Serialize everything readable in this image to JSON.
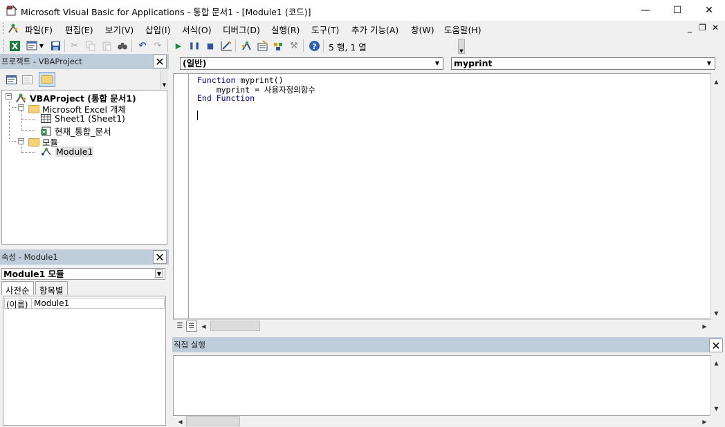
{
  "window": {
    "title": "Microsoft Visual Basic for Applications - 통합 문서1 - [Module1 (코드)]",
    "minimize": "—",
    "maximize": "☐",
    "close": "✕"
  },
  "menu": {
    "items": [
      "파일(F)",
      "편집(E)",
      "보기(V)",
      "삽입(I)",
      "서식(O)",
      "디버그(D)",
      "실행(R)",
      "도구(T)",
      "추가 기능(A)",
      "창(W)",
      "도움말(H)"
    ],
    "mdi_min": "_",
    "mdi_restore": "❐",
    "mdi_close": "✕"
  },
  "toolbar": {
    "status": "5 행, 1 열",
    "icons": [
      "excel-icon",
      "insert-module-icon",
      "save-icon",
      "cut-icon",
      "copy-icon",
      "paste-icon",
      "find-icon",
      "undo-icon",
      "redo-icon",
      "run-icon",
      "break-icon",
      "reset-icon",
      "design-mode-icon",
      "project-explorer-icon",
      "properties-icon",
      "object-browser-icon",
      "toolbox-icon",
      "help-icon"
    ]
  },
  "project_explorer": {
    "title": "프로젝트 - VBAProject",
    "tree": {
      "root": "VBAProject (통합 문서1)",
      "folder_objects": "Microsoft Excel 개체",
      "sheet1": "Sheet1 (Sheet1)",
      "workbook": "현재_통합_문서",
      "folder_modules": "모듈",
      "module1": "Module1"
    }
  },
  "properties": {
    "title": "속성 - Module1",
    "object_select": "Module1 모듈",
    "tabs": [
      "사전순",
      "항목별"
    ],
    "rows": [
      {
        "name": "(이름)",
        "value": "Module1"
      }
    ]
  },
  "code": {
    "object_combo": "(일반)",
    "proc_combo": "myprint",
    "lines": [
      {
        "kw": "Function",
        "rest": " myprint()"
      },
      {
        "kw": "",
        "rest": "    myprint = 사용자정의함수"
      },
      {
        "kw": "End Function",
        "rest": ""
      }
    ]
  },
  "immediate": {
    "title": "직접 실행"
  },
  "colors": {
    "panel_header": "#bfcddb",
    "keyword": "#00007f"
  }
}
